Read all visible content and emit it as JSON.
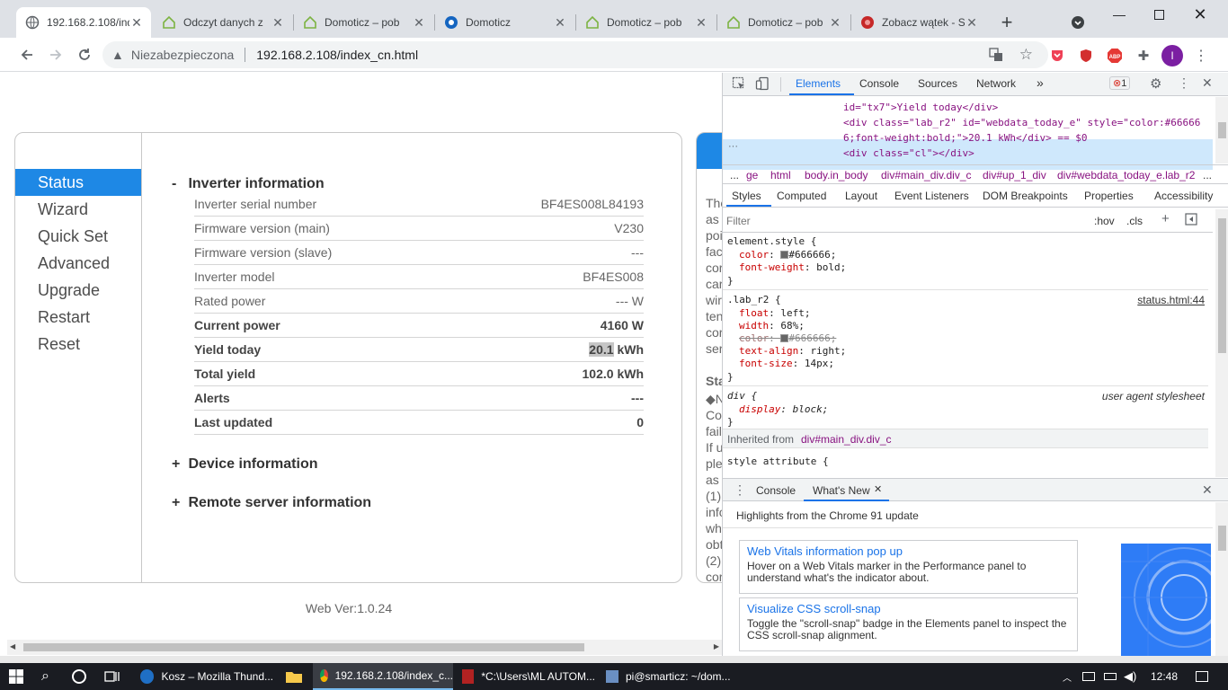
{
  "browser": {
    "tabs": [
      {
        "title": "192.168.2.108/index_cn.html",
        "icon": "globe-icon",
        "active": true
      },
      {
        "title": "Odczyt danych z",
        "icon": "domoticz-icon"
      },
      {
        "title": "Domoticz – pob",
        "icon": "domoticz-icon"
      },
      {
        "title": "Domoticz",
        "icon": "domoticz-app-icon"
      },
      {
        "title": "Domoticz – pob",
        "icon": "domoticz-icon"
      },
      {
        "title": "Domoticz – pob",
        "icon": "domoticz-icon"
      },
      {
        "title": "Zobacz wątek - S",
        "icon": "forum-icon"
      }
    ],
    "address": {
      "security_label": "Niezabezpieczona",
      "url": "192.168.2.108/index_cn.html"
    },
    "profile_initial": "I",
    "extensions": {
      "abp": "ABP"
    }
  },
  "page": {
    "menu": [
      "Status",
      "Wizard",
      "Quick Set",
      "Advanced",
      "Upgrade",
      "Restart",
      "Reset"
    ],
    "sections": {
      "inverter": {
        "sign": "-",
        "title": "Inverter information"
      },
      "device": {
        "sign": "+",
        "title": "Device information"
      },
      "remote": {
        "sign": "+",
        "title": "Remote server information"
      }
    },
    "inverter_rows": [
      {
        "label": "Inverter serial number",
        "value": "BF4ES008L84193"
      },
      {
        "label": "Firmware version (main)",
        "value": "V230"
      },
      {
        "label": "Firmware version (slave)",
        "value": "---"
      },
      {
        "label": "Inverter model",
        "value": "BF4ES008"
      },
      {
        "label": "Rated power",
        "value": "--- W"
      },
      {
        "label": "Current power",
        "value": "4160 W"
      },
      {
        "label": "Yield today",
        "value_num": "20.1",
        "value_unit": "kWh"
      },
      {
        "label": "Total yield",
        "value": "102.0 kWh"
      },
      {
        "label": "Alerts",
        "value": "---"
      },
      {
        "label": "Last updated",
        "value": "0"
      }
    ],
    "web_version": "Web Ver:1.0.24",
    "right_panel_text": [
      "The",
      "as",
      "poi",
      "fac",
      "cor",
      "car",
      "wir",
      "ten",
      "cor",
      "ser",
      "Sta",
      "◆N",
      "Co",
      "fail",
      "If u",
      "ple",
      "as",
      "(1)",
      "info",
      "wh",
      "obt",
      "(2)",
      "cor"
    ]
  },
  "devtools": {
    "tabs": [
      "Elements",
      "Console",
      "Sources",
      "Network"
    ],
    "more": "»",
    "error_count": "1",
    "code_lines": [
      "id=\"tx7\">Yield today</div>",
      "<div class=\"lab_r2\" id=\"webdata_today_e\" style=\"color:#66666",
      "6;font-weight:bold;\">20.1 kWh</div> == $0",
      "<div class=\"cl\"></div>"
    ],
    "breadcrumbs": [
      "...",
      "ge",
      "html",
      "body.in_body",
      "div#main_div.div_c",
      "div#up_1_div",
      "div#webdata_today_e.lab_r2",
      "..."
    ],
    "subtabs": [
      "Styles",
      "Computed",
      "Layout",
      "Event Listeners",
      "DOM Breakpoints",
      "Properties",
      "Accessibility"
    ],
    "filter_placeholder": "Filter",
    "hov": ":hov",
    "cls": ".cls",
    "styles": {
      "element_style": "element.style {",
      "es_color_prop": "color",
      "es_color_val": "#666666;",
      "es_weight_prop": "font-weight",
      "es_weight_val": "bold;",
      "close": "}",
      "lab_selector": ".lab_r2 {",
      "lab_source": "status.html:44",
      "lab_props": [
        {
          "p": "float",
          "v": "left;"
        },
        {
          "p": "width",
          "v": "68%;"
        },
        {
          "p": "color",
          "v": "#666666;"
        },
        {
          "p": "text-align",
          "v": "right;"
        },
        {
          "p": "font-size",
          "v": "14px;"
        }
      ],
      "div_selector": "div {",
      "div_source": "user agent stylesheet",
      "div_prop": "display",
      "div_val": "block;",
      "inherited_label": "Inherited from",
      "inherited_from": "div#main_div.div_c",
      "style_attr": "style attribute {"
    },
    "drawer": {
      "tabs": [
        "Console",
        "What's New"
      ],
      "headline": "Highlights from the Chrome 91 update",
      "cards": [
        {
          "title": "Web Vitals information pop up",
          "desc": "Hover on a Web Vitals marker in the Performance panel to understand what's the indicator about."
        },
        {
          "title": "Visualize CSS scroll-snap",
          "desc": "Toggle the \"scroll-snap\" badge in the Elements panel to inspect the CSS scroll-snap alignment."
        }
      ]
    }
  },
  "taskbar": {
    "items": [
      {
        "label": "Kosz – Mozilla Thund..."
      },
      {
        "label": "192.168.2.108/index_c..."
      },
      {
        "label": "*C:\\Users\\ML AUTOM..."
      },
      {
        "label": "pi@smarticz: ~/dom..."
      }
    ],
    "time": "12:48"
  },
  "colors": {
    "accent": "#1e88e5",
    "devtools_blue": "#1a73e8",
    "taskbar": "#1a1c22"
  }
}
